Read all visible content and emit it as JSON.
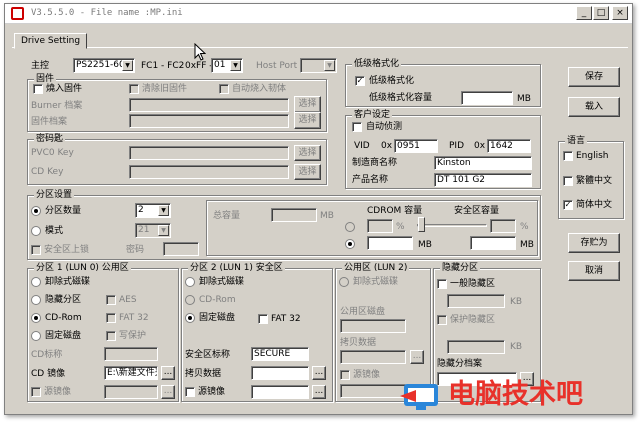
{
  "window": {
    "title": "V3.5.5.0 - File name :MP.ini",
    "icon": "app-logo-icon"
  },
  "titlebar_buttons": {
    "minimize": "_",
    "maximize": "□",
    "close": "×"
  },
  "tab": "Drive Setting",
  "top": {
    "controller_label": "主控",
    "controller_value": "PS2251-60",
    "fc_label": "FC1 - FC2",
    "fc_prefix": "0xFF -",
    "fc_value": "01",
    "host_port_label": "Host Port",
    "host_port_value": ""
  },
  "firmware": {
    "legend": "固件",
    "burn_label": "燒入固件",
    "clear_label": "清除旧固件",
    "auto_label": "自动烧入韧体",
    "burner_label": "Burner 档案",
    "fw_label": "固件档案",
    "browse1": "选择",
    "browse2": "选择"
  },
  "password": {
    "legend": "密码匙",
    "pvc0_label": "PVC0 Key",
    "cd_label": "CD Key",
    "browse1": "选择",
    "browse2": "选择"
  },
  "low_format": {
    "legend": "低级格式化",
    "check_label": "低级格式化",
    "capacity_label": "低级格式化容量",
    "capacity_value": "",
    "unit": "MB"
  },
  "customer": {
    "legend": "客户设定",
    "auto_detect_label": "自动侦测",
    "vid_label": "VID",
    "vid_prefix": "0x",
    "vid_value": "0951",
    "pid_label": "PID",
    "pid_prefix": "0x",
    "pid_value": "1642",
    "vendor_label": "制造商名称",
    "vendor_value": "Kinston",
    "product_label": "产品名称",
    "product_value": "DT 101 G2"
  },
  "buttons": {
    "save": "保存",
    "load": "载入",
    "save_as": "存贮为",
    "cancel": "取消"
  },
  "language": {
    "legend": "语言",
    "options": [
      {
        "label": "English",
        "checked": false
      },
      {
        "label": "繁體中文",
        "checked": false
      },
      {
        "label": "简体中文",
        "checked": true
      }
    ]
  },
  "partition": {
    "legend": "分区设置",
    "count_label": "分区数量",
    "count_value": "2",
    "mode_label": "模式",
    "mode_value": "21",
    "lock_label": "安全区上锁",
    "password_label": "密码",
    "total_label": "总容量",
    "total_unit": "MB",
    "cdrom_label": "CDROM 容量",
    "secure_label": "安全区容量",
    "percent": "%",
    "mb": "MB",
    "slider_percent": 0
  },
  "p1": {
    "legend": "分区 1 (LUN 0) 公用区",
    "removable": "卸除式磁碟",
    "hidden": "隐藏分区",
    "aes": "AES",
    "cdrom": "CD-Rom",
    "fat32": "FAT 32",
    "fixed": "固定磁盘",
    "write_protect": "写保护",
    "cd_label_label": "CD标称",
    "cd_image_label": "CD 镜像",
    "cd_image_value": "E:\\新建文件夹",
    "source_image_label": "源镜像",
    "more": "..."
  },
  "p2": {
    "legend": "分区 2 (LUN 1) 安全区",
    "removable": "卸除式磁碟",
    "cdrom": "CD-Rom",
    "fixed": "固定磁盘",
    "fat32": "FAT 32",
    "secure_label_label": "安全区标称",
    "secure_label_value": "SECURE",
    "copy_label": "拷贝数据",
    "source_image_label": "源镜像",
    "more": "..."
  },
  "p3": {
    "legend": "公用区 (LUN 2)",
    "removable": "卸除式磁碟",
    "disk_label": "公用区磁盘",
    "copy_label": "拷贝数据",
    "source_image_label": "源镜像",
    "more": "..."
  },
  "hidden": {
    "legend": "隐藏分区",
    "general_label": "一般隐藏区",
    "kb1": "KB",
    "protect_label": "保护隐藏区",
    "kb2": "KB",
    "file_label": "隐藏分档案",
    "more": "..."
  },
  "watermark": {
    "text": "电脑技术吧",
    "color": "#e8312a"
  }
}
